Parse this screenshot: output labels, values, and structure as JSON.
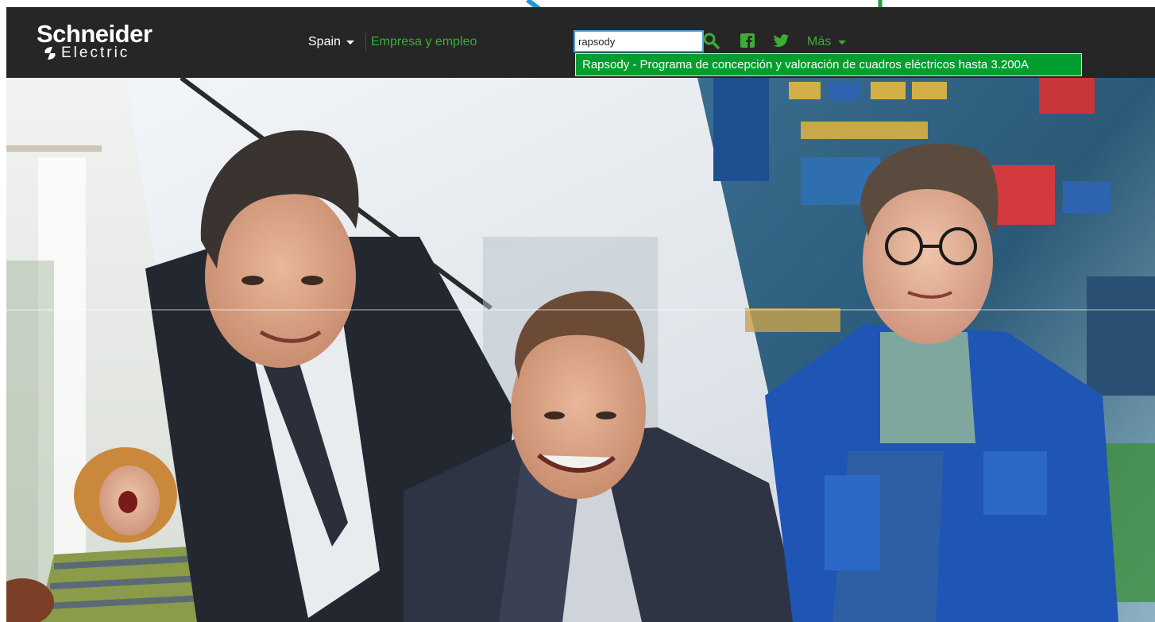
{
  "header": {
    "logo_main": "Schneider",
    "logo_sub": "Electric",
    "country": "Spain",
    "business_link": "Empresa y empleo",
    "more_label": "Más"
  },
  "search": {
    "value": "rapsody",
    "suggestion": "Rapsody - Programa de concepción y valoración de cuadros eléctricos hasta 3.200A"
  },
  "icons": {
    "search": "search-icon",
    "facebook": "facebook-icon",
    "twitter": "twitter-icon"
  },
  "colors": {
    "header_bg": "#262626",
    "accent_green": "#3dac34",
    "suggestion_bg": "#009e2e",
    "annotation_blue": "#1a9ad6",
    "annotation_green": "#1f9e3a"
  }
}
